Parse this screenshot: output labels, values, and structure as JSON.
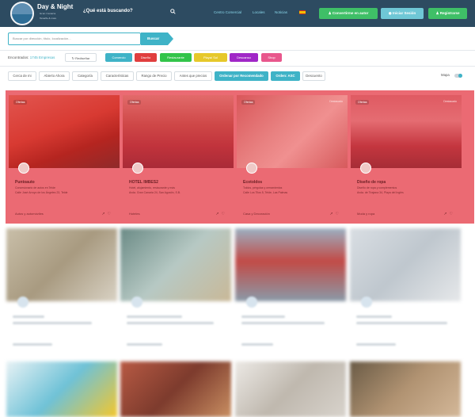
{
  "header": {
    "brand_title": "Day & Night",
    "brand_sub": "Gran Canaria",
    "brand_sub2": "Tenerife & more",
    "search_prompt": "¿Qué está buscando?",
    "search_icon": "search-icon",
    "nav": [
      "Centro Comercial",
      "Locales",
      "Noticias"
    ],
    "lang_flag": "flag-es-icon",
    "buttons": {
      "become_author": "Convertirme en autor",
      "login": "Iniciar Sesión",
      "register": "Registrarse"
    },
    "colors": {
      "bar": "#2d4b61",
      "green": "#3fbf67",
      "teal": "#3fb3c7",
      "link": "#8ad7ea"
    }
  },
  "search": {
    "placeholder": "Buscar por dirección, título, localización...",
    "button": "Buscar"
  },
  "results": {
    "found_label": "Encontrados:",
    "found_count": "1745 Empresas",
    "refine": "Rediseñar",
    "tags": [
      {
        "label": "Comercio",
        "color": "#3fb3c7"
      },
      {
        "label": "Diseño",
        "color": "#e03e3e"
      },
      {
        "label": "Restaurante",
        "color": "#32c44a"
      },
      {
        "label": "Playa/ Sol",
        "color": "#e6c82a"
      },
      {
        "label": "Descanso",
        "color": "#a027c7"
      },
      {
        "label": "Shop",
        "color": "#e8578c"
      }
    ]
  },
  "filters": {
    "items": [
      "Cerca de mi",
      "Abierto Ahora",
      "Categoría",
      "Características",
      "Rango de Precio",
      "Antes que precios",
      "Ordenar por Recomendado",
      "Orden: ASC",
      "Descuento"
    ],
    "maps_label": "Mapa"
  },
  "cards": [
    {
      "title": "Puntoauto",
      "line1": "Concesionario de autos en Telde",
      "line2": "Calle José Arroyo de los Ángeles 23, Telde",
      "category": "Autos y automóviles",
      "badge": "Ofertas",
      "corner": ""
    },
    {
      "title": "HOTEL IMBES2",
      "line1": "Hotel, alojamiento, restaurante y más",
      "line2": "Avda. Gran Canaria 24, San Agustín, S.B.",
      "category": "Hoteles",
      "badge": "Ofertas",
      "corner": ""
    },
    {
      "title": "Ecotoldos",
      "line1": "Toldos, pérgolas y cerramientos",
      "line2": "Calle Los Tilos 5, Telde, Las Palmas",
      "category": "Casa y Decoración",
      "badge": "Ofertas",
      "corner": "Destacado"
    },
    {
      "title": "Diseño de ropa",
      "line1": "Diseño de ropa y complementos",
      "line2": "Avda. de Tirajana 34, Playa del Inglés",
      "category": "Moda y ropa",
      "badge": "Ofertas",
      "corner": "Destacado"
    }
  ]
}
